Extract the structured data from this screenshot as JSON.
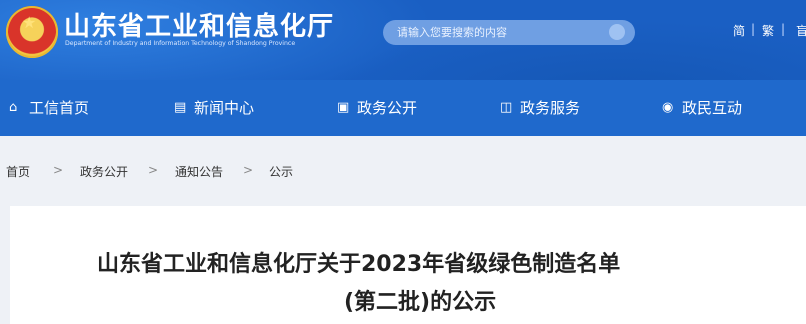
{
  "header": {
    "title": "山东省工业和信息化厅",
    "subtitle": "Department of Industry and Information Technology of Shandong Province",
    "search_placeholder": "请输入您要搜索的内容",
    "lang_simplified": "简",
    "lang_traditional": "繁",
    "lang_cut": "盲"
  },
  "nav": {
    "items": [
      {
        "label": "工信首页",
        "icon": "home-icon"
      },
      {
        "label": "新闻中心",
        "icon": "news-icon"
      },
      {
        "label": "政务公开",
        "icon": "monitor-icon"
      },
      {
        "label": "政务服务",
        "icon": "service-icon"
      },
      {
        "label": "政民互动",
        "icon": "chat-icon"
      }
    ]
  },
  "breadcrumb": {
    "items": [
      "首页",
      "政务公开",
      "通知公告",
      "公示"
    ],
    "separator": ">"
  },
  "article": {
    "title_line1": "山东省工业和信息化厅关于2023年省级绿色制造名单",
    "title_line2": "(第二批)的公示"
  },
  "colors": {
    "header_bg": "#1a5fc3",
    "nav_bg": "#1f69cc",
    "page_bg": "#eef1f6"
  }
}
